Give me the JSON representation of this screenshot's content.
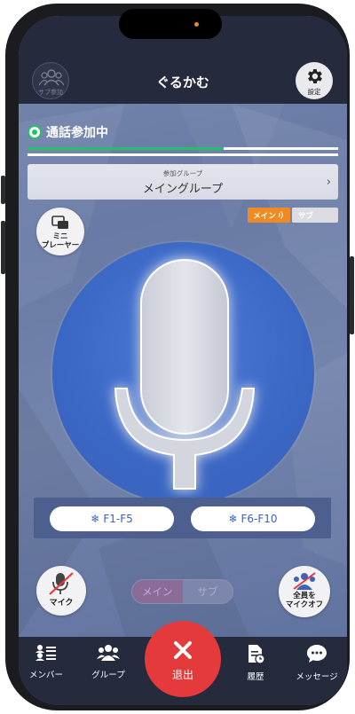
{
  "header": {
    "title": "ぐるかむ",
    "sub_join_label": "サブ参加",
    "settings_label": "設定"
  },
  "status": {
    "text": "通話参加中",
    "level": 0.63
  },
  "group": {
    "caption": "参加グループ",
    "name": "メイングループ",
    "chevron": "›"
  },
  "route": {
    "main_label": "メイン",
    "sub_label": "サブ"
  },
  "mini_player": {
    "line1": "ミニ",
    "line2": "プレーヤー"
  },
  "fkeys": {
    "left_label": "F1-F5",
    "right_label": "F6-F10"
  },
  "mic_button": {
    "label": "マイク",
    "state": "muted"
  },
  "toggle": {
    "main_label": "メイン",
    "sub_label": "サブ"
  },
  "all_mute": {
    "line1": "全員を",
    "line2": "マイクオフ"
  },
  "tabs": {
    "members": "メンバー",
    "groups": "グループ",
    "exit": "退出",
    "history": "履歴",
    "messages": "メッセージ"
  },
  "colors": {
    "accent_green": "#22c268",
    "main_orange": "#f08b21",
    "exit_red": "#e53a3c",
    "nav_dark": "#262a3d",
    "mic_blue": "#3a67c4"
  }
}
